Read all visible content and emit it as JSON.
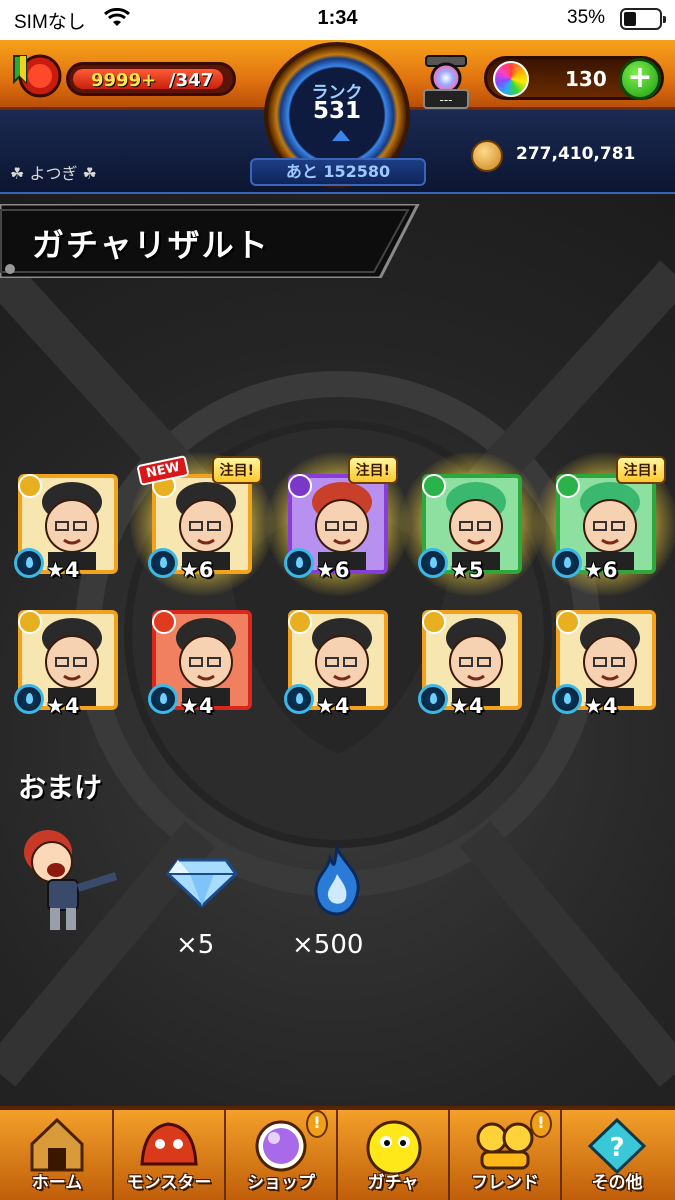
{
  "status_bar": {
    "carrier": "SIMなし",
    "time": "1:34",
    "battery": "35%"
  },
  "hud": {
    "stamina_current": "9999+",
    "stamina_max": "/347",
    "rank_label": "ランク",
    "rank_value": "531",
    "rank_remaining": "あと 152580",
    "machine_label": "---",
    "orb_count": "130",
    "gold": "277,410,781",
    "account_name": "よつぎ"
  },
  "title": "ガチャリザルト",
  "results": [
    {
      "stars": "★4",
      "element": "light",
      "frame": "gold",
      "glow": false,
      "badge_new": "",
      "badge_note": ""
    },
    {
      "stars": "★6",
      "element": "light",
      "frame": "gold",
      "glow": true,
      "badge_new": "NEW",
      "badge_note": "注目!"
    },
    {
      "stars": "★6",
      "element": "dark",
      "frame": "purple",
      "glow": true,
      "badge_new": "",
      "badge_note": "注目!"
    },
    {
      "stars": "★5",
      "element": "wood",
      "frame": "green",
      "glow": true,
      "badge_new": "",
      "badge_note": ""
    },
    {
      "stars": "★6",
      "element": "wood",
      "frame": "green",
      "glow": true,
      "badge_new": "",
      "badge_note": "注目!"
    },
    {
      "stars": "★4",
      "element": "light",
      "frame": "gold",
      "glow": false,
      "badge_new": "",
      "badge_note": ""
    },
    {
      "stars": "★4",
      "element": "fire",
      "frame": "red",
      "glow": false,
      "badge_new": "",
      "badge_note": ""
    },
    {
      "stars": "★4",
      "element": "light",
      "frame": "gold",
      "glow": false,
      "badge_new": "",
      "badge_note": ""
    },
    {
      "stars": "★4",
      "element": "light",
      "frame": "gold",
      "glow": false,
      "badge_new": "",
      "badge_note": ""
    },
    {
      "stars": "★4",
      "element": "light",
      "frame": "gold",
      "glow": false,
      "badge_new": "",
      "badge_note": ""
    }
  ],
  "bonus": {
    "heading": "おまけ",
    "gem_count": "×5",
    "flame_count": "×500"
  },
  "nav": [
    {
      "label": "ホーム",
      "icon": "home-icon",
      "alert": ""
    },
    {
      "label": "モンスター",
      "icon": "monster-icon",
      "alert": ""
    },
    {
      "label": "ショップ",
      "icon": "shop-orb-icon",
      "alert": "!"
    },
    {
      "label": "ガチャ",
      "icon": "gacha-icon",
      "alert": ""
    },
    {
      "label": "フレンド",
      "icon": "friend-icon",
      "alert": "!"
    },
    {
      "label": "その他",
      "icon": "other-icon",
      "alert": ""
    }
  ],
  "colors": {
    "frame_gold": "#f2a21c",
    "frame_purple": "#8a3cd8",
    "frame_green": "#2ea83a",
    "frame_red": "#d8281c",
    "elem_light": "#e8b020",
    "elem_dark": "#7a38c8",
    "elem_wood": "#2ab34a",
    "elem_fire": "#e03a20"
  }
}
